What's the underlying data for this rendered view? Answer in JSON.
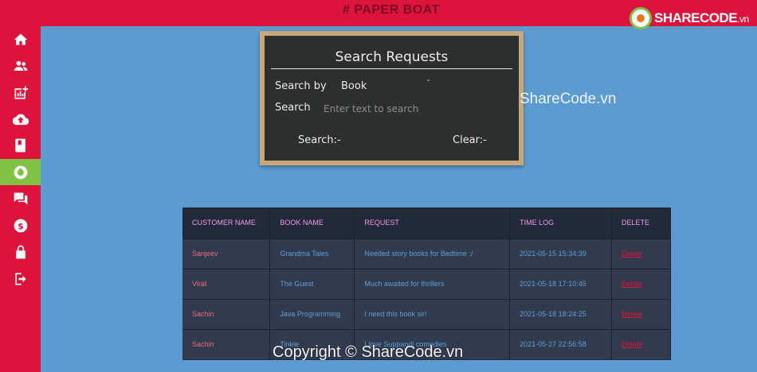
{
  "header": {
    "brand": "#  PAPER BOAT"
  },
  "logo": {
    "name": "SHARECODE",
    "suffix": ".vn"
  },
  "sidebar": {
    "items": [
      {
        "icon": "home-icon"
      },
      {
        "icon": "users-icon"
      },
      {
        "icon": "chart-add-icon"
      },
      {
        "icon": "upload-icon"
      },
      {
        "icon": "book-icon"
      },
      {
        "icon": "requests-icon",
        "active": true
      },
      {
        "icon": "chat-icon"
      },
      {
        "icon": "dollar-icon"
      },
      {
        "icon": "lock-icon"
      },
      {
        "icon": "logout-icon"
      }
    ],
    "active_color": "#7fc241",
    "color": "#dc143c"
  },
  "search": {
    "title": "Search Requests",
    "search_by_label": "Search by",
    "search_by_value": "Book",
    "search_label": "Search",
    "placeholder": "Enter text to search",
    "search_button": "Search:-",
    "clear_button": "Clear:-"
  },
  "table": {
    "headers": [
      "CUSTOMER NAME",
      "BOOK NAME",
      "REQUEST",
      "TIME LOG",
      "DELETE"
    ],
    "rows": [
      {
        "customer": "Sanjeev",
        "book": "Grandma Tales",
        "request": "Needed story books for Bedtime :/",
        "time": "2021-05-15 15:34:39",
        "delete": "Delete"
      },
      {
        "customer": "Virat",
        "book": "The Guest",
        "request": "Much awaited for thrillers",
        "time": "2021-05-18 17:10:45",
        "delete": "Delete"
      },
      {
        "customer": "Sachin",
        "book": "Java Programming",
        "request": "I need this book sir!",
        "time": "2021-05-18 18:24:25",
        "delete": "Delete"
      },
      {
        "customer": "Sachin",
        "book": "Tinkle",
        "request": "I love Suppandi comedies",
        "time": "2021-05-27 22:56:58",
        "delete": "Delete"
      }
    ]
  },
  "watermarks": {
    "right": "ShareCode.vn",
    "bottom": "Copyright © ShareCode.vn"
  }
}
